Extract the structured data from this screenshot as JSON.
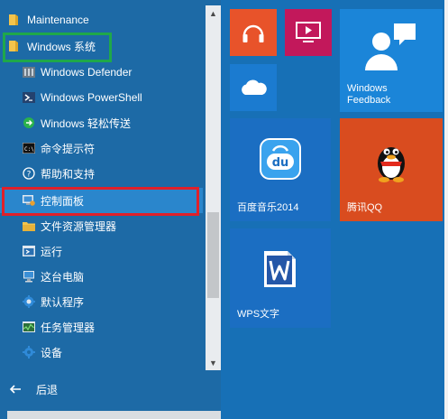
{
  "menu": {
    "items": [
      {
        "label": "Maintenance",
        "icon": "folder-icon",
        "level": "top"
      },
      {
        "label": "Windows 系统",
        "icon": "folder-icon",
        "level": "top"
      },
      {
        "label": "Windows Defender",
        "icon": "defender-icon",
        "level": "sub"
      },
      {
        "label": "Windows PowerShell",
        "icon": "powershell-icon",
        "level": "sub"
      },
      {
        "label": "Windows 轻松传送",
        "icon": "easy-transfer-icon",
        "level": "sub"
      },
      {
        "label": "命令提示符",
        "icon": "cmd-icon",
        "level": "sub"
      },
      {
        "label": "帮助和支持",
        "icon": "help-icon",
        "level": "sub"
      },
      {
        "label": "控制面板",
        "icon": "control-panel-icon",
        "level": "sub"
      },
      {
        "label": "文件资源管理器",
        "icon": "file-explorer-icon",
        "level": "sub"
      },
      {
        "label": "运行",
        "icon": "run-icon",
        "level": "sub"
      },
      {
        "label": "这台电脑",
        "icon": "this-pc-icon",
        "level": "sub"
      },
      {
        "label": "默认程序",
        "icon": "default-programs-icon",
        "level": "sub"
      },
      {
        "label": "任务管理器",
        "icon": "task-manager-icon",
        "level": "sub"
      },
      {
        "label": "设备",
        "icon": "devices-icon",
        "level": "sub"
      }
    ],
    "back_label": "后退",
    "selected_index": 7
  },
  "tiles": {
    "music": {
      "icon": "headphones-icon",
      "color": "#e8532a"
    },
    "video": {
      "icon": "video-icon",
      "color": "#c2185b"
    },
    "onedrive": {
      "icon": "cloud-icon",
      "color": "#1b7bd0"
    },
    "feedback": {
      "label_line1": "Windows",
      "label_line2": "Feedback",
      "icon": "feedback-person-icon",
      "color": "#1b85d8"
    },
    "baidu_music": {
      "label": "百度音乐2014",
      "icon": "baidu-music-icon",
      "color": "#1b6ec2"
    },
    "qq": {
      "label": "腾讯QQ",
      "icon": "qq-penguin-icon",
      "color": "#d94c1f"
    },
    "wps": {
      "label": "WPS文字",
      "icon": "wps-icon",
      "color": "#1b6ec2"
    }
  },
  "annotations": {
    "green_box": "#1fa84a",
    "red_box": "#e0202a"
  },
  "colors": {
    "background": "#1770b6",
    "left_panel": "#1d6aa6",
    "selected": "#2a86cc"
  }
}
